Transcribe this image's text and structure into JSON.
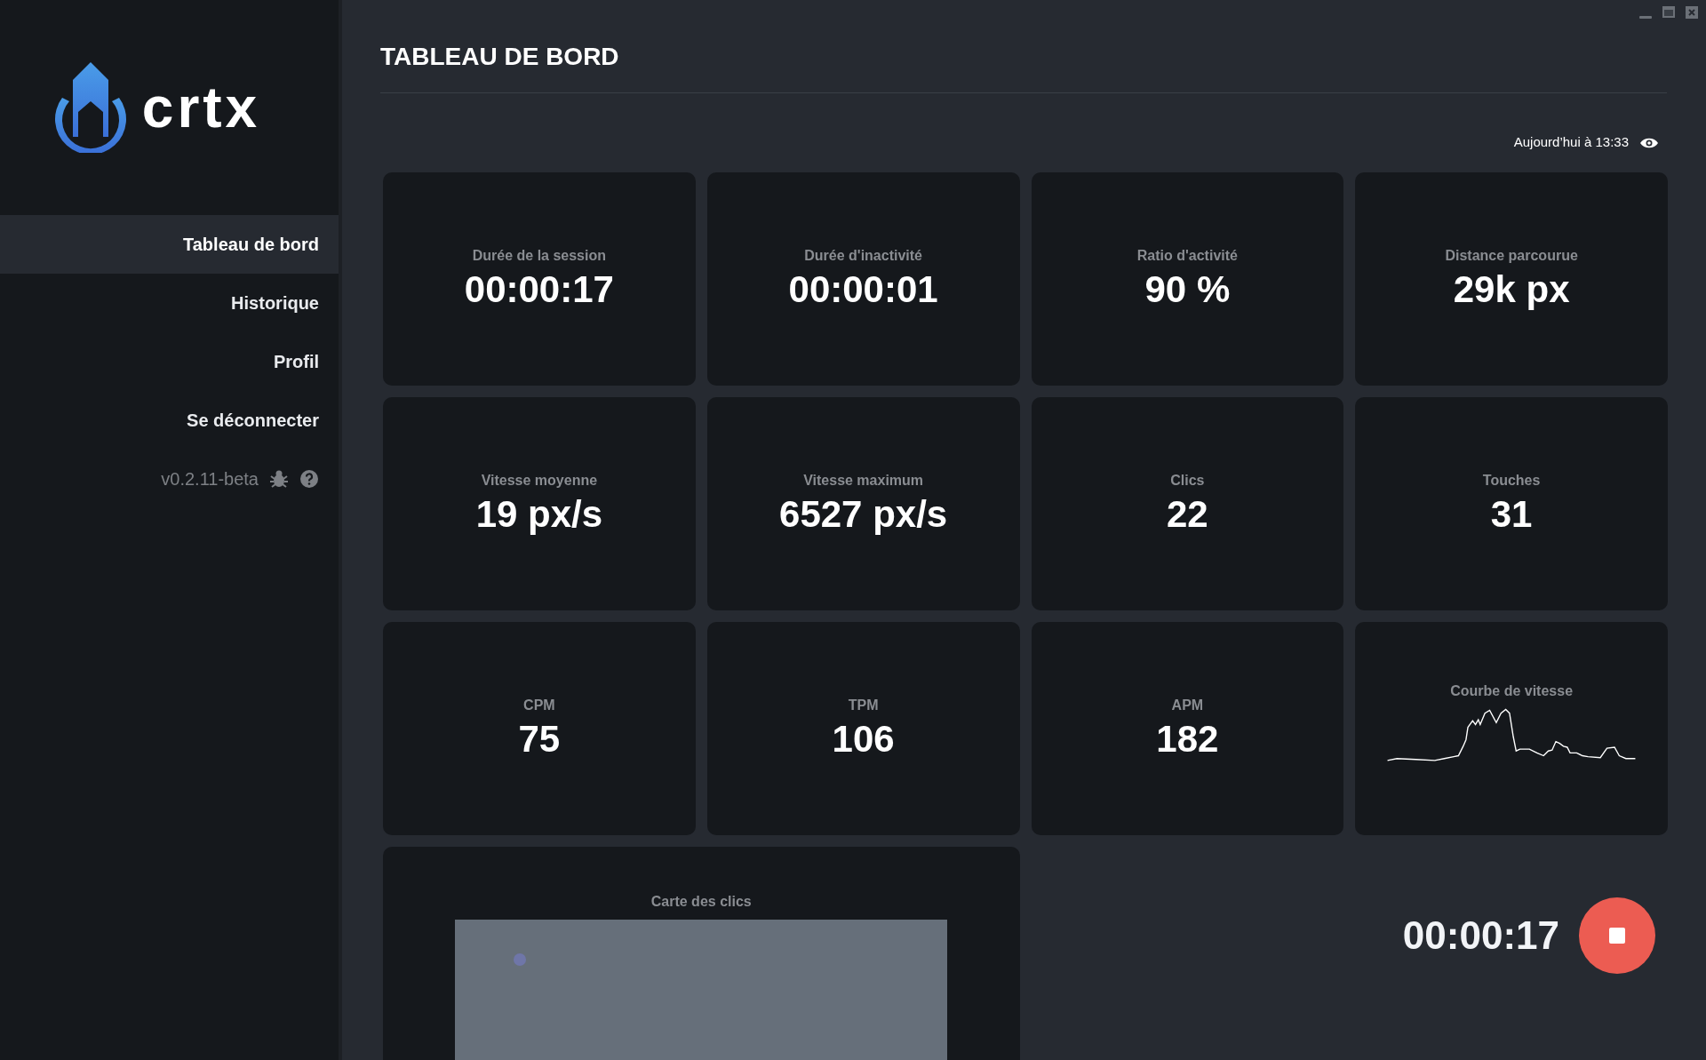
{
  "sidebar": {
    "logo_text": "crtx",
    "items": [
      {
        "label": "Tableau de bord",
        "selected": true
      },
      {
        "label": "Historique",
        "selected": false
      },
      {
        "label": "Profil",
        "selected": false
      },
      {
        "label": "Se déconnecter",
        "selected": false
      }
    ],
    "version": "v0.2.11-beta"
  },
  "header": {
    "title": "TABLEAU DE BORD",
    "timestamp": "Aujourd’hui à 13:33"
  },
  "stats": [
    {
      "kind": "value",
      "label": "Durée de la session",
      "value": "00:00:17"
    },
    {
      "kind": "value",
      "label": "Durée d'inactivité",
      "value": "00:00:01"
    },
    {
      "kind": "value",
      "label": "Ratio d'activité",
      "value": "90 %"
    },
    {
      "kind": "value",
      "label": "Distance parcourue",
      "value": "29k px"
    },
    {
      "kind": "value",
      "label": "Vitesse moyenne",
      "value": "19 px/s"
    },
    {
      "kind": "value",
      "label": "Vitesse maximum",
      "value": "6527 px/s"
    },
    {
      "kind": "value",
      "label": "Clics",
      "value": "22"
    },
    {
      "kind": "value",
      "label": "Touches",
      "value": "31"
    },
    {
      "kind": "value",
      "label": "CPM",
      "value": "75"
    },
    {
      "kind": "value",
      "label": "TPM",
      "value": "106"
    },
    {
      "kind": "value",
      "label": "APM",
      "value": "182"
    },
    {
      "kind": "sparkline",
      "label": "Courbe de vitesse"
    }
  ],
  "click_map": {
    "title": "Carte des clics"
  },
  "recorder": {
    "elapsed": "00:00:17",
    "recording": true
  }
}
